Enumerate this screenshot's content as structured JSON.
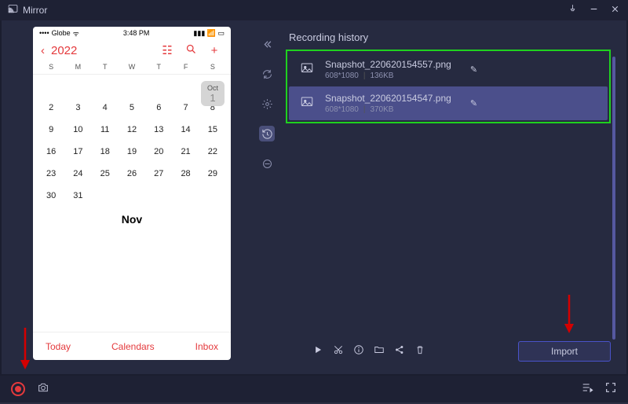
{
  "titlebar": {
    "app_name": "Mirror"
  },
  "phone": {
    "status": {
      "carrier": "Globe",
      "time": "3:48 PM"
    },
    "calendar": {
      "year": "2022",
      "dow": [
        "S",
        "M",
        "T",
        "W",
        "T",
        "F",
        "S"
      ],
      "month_tag": {
        "label": "Oct",
        "day": "1"
      },
      "oct_lead_blanks": 6,
      "oct_days": [
        "1",
        "2",
        "3",
        "4",
        "5",
        "6",
        "7",
        "8",
        "9",
        "10",
        "11",
        "12",
        "13",
        "14",
        "15",
        "16",
        "17",
        "18",
        "19",
        "20",
        "21",
        "22",
        "23",
        "24",
        "25",
        "26",
        "27",
        "28",
        "29",
        "30",
        "31"
      ],
      "next_month_label": "Nov",
      "bottom": {
        "today": "Today",
        "calendars": "Calendars",
        "inbox": "Inbox"
      }
    }
  },
  "panel": {
    "title": "Recording history",
    "items": [
      {
        "name": "Snapshot_220620154557.png",
        "dims": "608*1080",
        "size": "136KB",
        "selected": false
      },
      {
        "name": "Snapshot_220620154547.png",
        "dims": "608*1080",
        "size": "370KB",
        "selected": true
      }
    ],
    "import_label": "Import"
  }
}
